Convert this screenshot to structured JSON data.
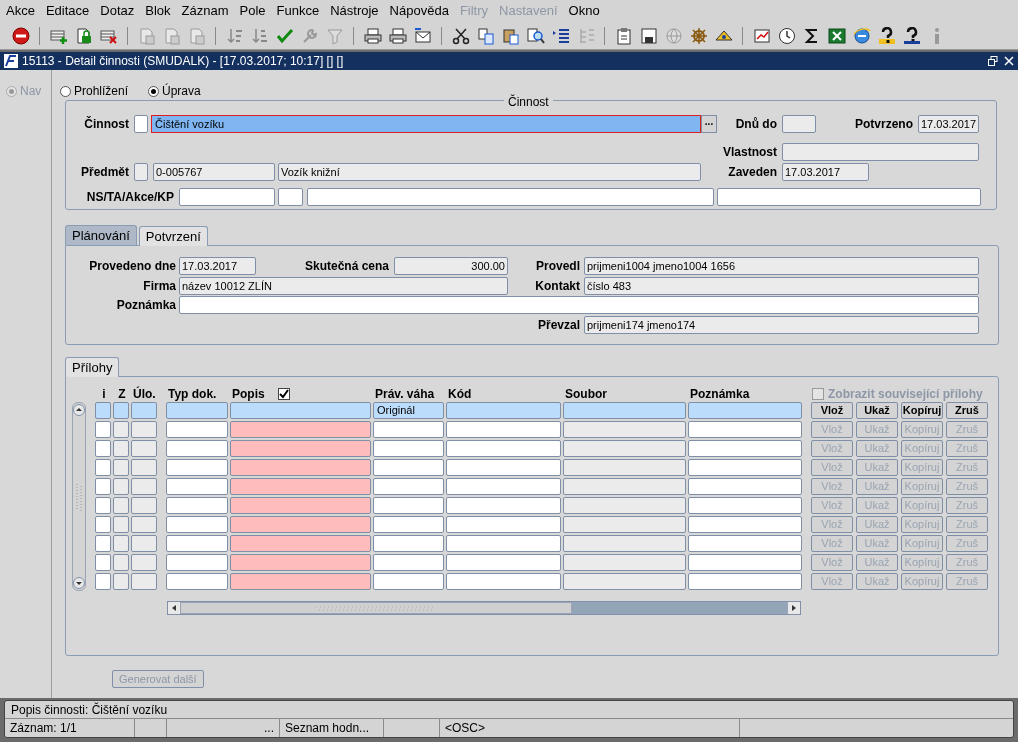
{
  "menu": [
    {
      "label": "Akce",
      "disabled": false
    },
    {
      "label": "Editace",
      "disabled": false
    },
    {
      "label": "Dotaz",
      "disabled": false
    },
    {
      "label": "Blok",
      "disabled": false
    },
    {
      "label": "Záznam",
      "disabled": false
    },
    {
      "label": "Pole",
      "disabled": false
    },
    {
      "label": "Funkce",
      "disabled": false
    },
    {
      "label": "Nástroje",
      "disabled": false
    },
    {
      "label": "Nápověda",
      "disabled": false
    },
    {
      "label": "Filtry",
      "disabled": true
    },
    {
      "label": "Nastavení",
      "disabled": true
    },
    {
      "label": "Okno",
      "disabled": false
    }
  ],
  "window": {
    "title": "15113 - Detail činnosti (SMUDALK) - [17.03.2017; 10:17] [] []"
  },
  "nav": {
    "label": "Nav",
    "disabled": true
  },
  "modes": [
    {
      "label": "Prohlížení",
      "selected": false
    },
    {
      "label": "Úprava",
      "selected": true
    }
  ],
  "group": {
    "title": "Činnost",
    "cinnost": {
      "label": "Činnost",
      "value": "Čištění vozíku",
      "focused": true,
      "lookup": "..."
    },
    "dnu_do": {
      "label": "Dnů do"
    },
    "potvrzeno": {
      "label": "Potvrzeno",
      "value": "17.03.2017"
    },
    "vlastnost": {
      "label": "Vlastnost"
    },
    "predmet": {
      "label": "Předmět",
      "code": "0-005767",
      "name": "Vozík knižní"
    },
    "zaveden": {
      "label": "Zaveden",
      "value": "17.03.2017"
    },
    "ns_ta": {
      "label": "NS/TA/Akce/KP"
    }
  },
  "tabs": [
    {
      "label": "Plánování",
      "selected": false
    },
    {
      "label": "Potvrzení",
      "selected": true
    }
  ],
  "confirmation": {
    "provedeno_dne": {
      "label": "Provedeno dne",
      "value": "17.03.2017"
    },
    "skutecna_cena": {
      "label": "Skutečná cena",
      "value": "300.00"
    },
    "provedl": {
      "label": "Provedl",
      "value": "prijmeni1004 jmeno1004 1656"
    },
    "firma": {
      "label": "Firma",
      "value": "název 10012  ZLÍN"
    },
    "kontakt": {
      "label": "Kontakt",
      "value": "číslo 483"
    },
    "poznamka": {
      "label": "Poznámka"
    },
    "prevzal": {
      "label": "Převzal",
      "value": "prijmeni174 jmeno174"
    }
  },
  "attachments": {
    "tab": "Přílohy",
    "columns": [
      "i",
      "Z",
      "Úlo.",
      "Typ dok.",
      "Popis",
      "Práv. váha",
      "Kód",
      "Soubor",
      "Poznámka"
    ],
    "popis_checked": true,
    "show_related": {
      "label": "Zobrazit související přílohy",
      "checked": false,
      "disabled": true
    },
    "rows": [
      {
        "selected": true,
        "prav_vaha": "Originál",
        "buttons": [
          {
            "label": "Vlož",
            "disabled": false
          },
          {
            "label": "Ukaž",
            "disabled": false
          },
          {
            "label": "Kopíruj",
            "disabled": false
          },
          {
            "label": "Zruš",
            "disabled": false
          }
        ]
      },
      {
        "selected": false,
        "buttons": [
          {
            "label": "Vlož",
            "disabled": true
          },
          {
            "label": "Ukaž",
            "disabled": true
          },
          {
            "label": "Kopíruj",
            "disabled": true
          },
          {
            "label": "Zruš",
            "disabled": true
          }
        ]
      },
      {
        "selected": false,
        "buttons": [
          {
            "label": "Vlož",
            "disabled": true
          },
          {
            "label": "Ukaž",
            "disabled": true
          },
          {
            "label": "Kopíruj",
            "disabled": true
          },
          {
            "label": "Zruš",
            "disabled": true
          }
        ]
      },
      {
        "selected": false,
        "buttons": [
          {
            "label": "Vlož",
            "disabled": true
          },
          {
            "label": "Ukaž",
            "disabled": true
          },
          {
            "label": "Kopíruj",
            "disabled": true
          },
          {
            "label": "Zruš",
            "disabled": true
          }
        ]
      },
      {
        "selected": false,
        "buttons": [
          {
            "label": "Vlož",
            "disabled": true
          },
          {
            "label": "Ukaž",
            "disabled": true
          },
          {
            "label": "Kopíruj",
            "disabled": true
          },
          {
            "label": "Zruš",
            "disabled": true
          }
        ]
      },
      {
        "selected": false,
        "buttons": [
          {
            "label": "Vlož",
            "disabled": true
          },
          {
            "label": "Ukaž",
            "disabled": true
          },
          {
            "label": "Kopíruj",
            "disabled": true
          },
          {
            "label": "Zruš",
            "disabled": true
          }
        ]
      },
      {
        "selected": false,
        "buttons": [
          {
            "label": "Vlož",
            "disabled": true
          },
          {
            "label": "Ukaž",
            "disabled": true
          },
          {
            "label": "Kopíruj",
            "disabled": true
          },
          {
            "label": "Zruš",
            "disabled": true
          }
        ]
      },
      {
        "selected": false,
        "buttons": [
          {
            "label": "Vlož",
            "disabled": true
          },
          {
            "label": "Ukaž",
            "disabled": true
          },
          {
            "label": "Kopíruj",
            "disabled": true
          },
          {
            "label": "Zruš",
            "disabled": true
          }
        ]
      },
      {
        "selected": false,
        "buttons": [
          {
            "label": "Vlož",
            "disabled": true
          },
          {
            "label": "Ukaž",
            "disabled": true
          },
          {
            "label": "Kopíruj",
            "disabled": true
          },
          {
            "label": "Zruš",
            "disabled": true
          }
        ]
      },
      {
        "selected": false,
        "buttons": [
          {
            "label": "Vlož",
            "disabled": true
          },
          {
            "label": "Ukaž",
            "disabled": true
          },
          {
            "label": "Kopíruj",
            "disabled": true
          },
          {
            "label": "Zruš",
            "disabled": true
          }
        ]
      }
    ]
  },
  "generate": {
    "label": "Generovat další",
    "disabled": true
  },
  "status_bar": {
    "message": "Popis činnosti: Čištění vozíku",
    "segments": [
      "Záznam: 1/1",
      "...",
      "Seznam hodn...",
      "<OSC>"
    ]
  }
}
